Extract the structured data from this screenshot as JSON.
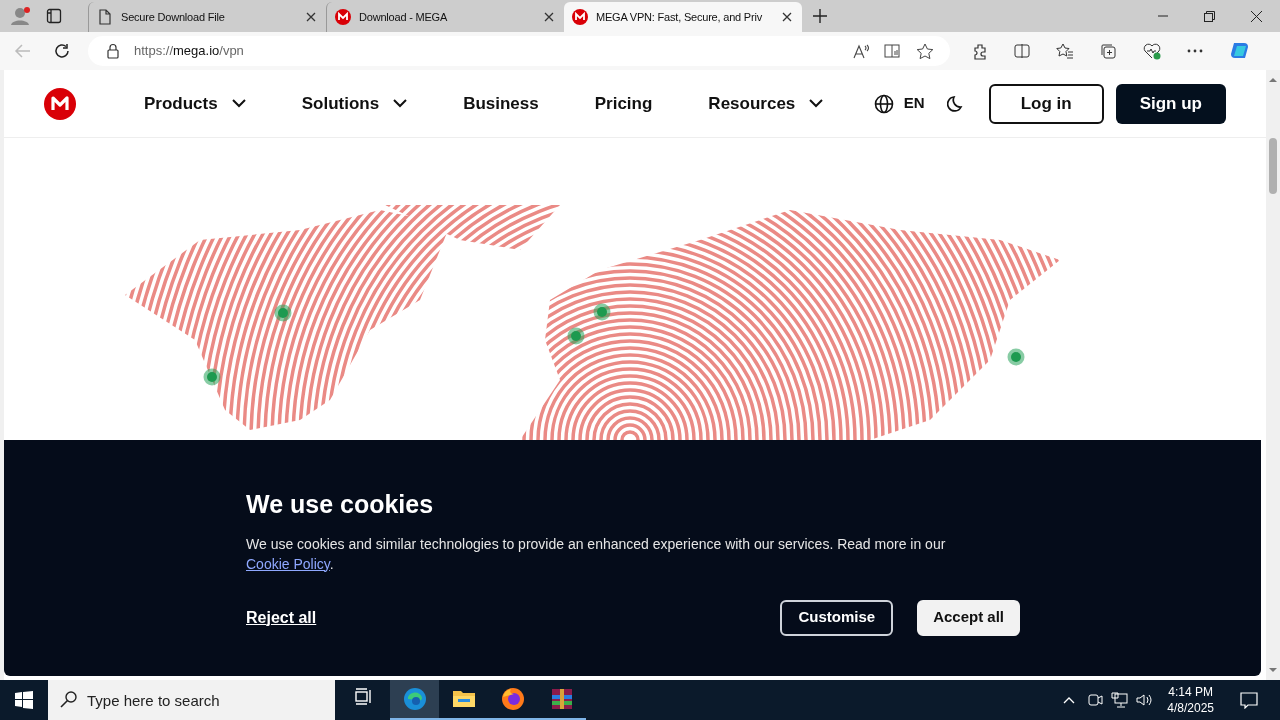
{
  "browser": {
    "tabs": [
      {
        "title": "Secure Download File",
        "kind": "page",
        "selected": false
      },
      {
        "title": "Download - MEGA",
        "kind": "mega",
        "selected": false
      },
      {
        "title": "MEGA VPN: Fast, Secure, and Priv",
        "kind": "mega",
        "selected": true
      }
    ],
    "address": {
      "scheme": "https://",
      "host": "mega.io",
      "path": "/vpn"
    }
  },
  "site": {
    "nav": [
      {
        "label": "Products",
        "dropdown": true
      },
      {
        "label": "Solutions",
        "dropdown": true
      },
      {
        "label": "Business",
        "dropdown": false
      },
      {
        "label": "Pricing",
        "dropdown": false
      },
      {
        "label": "Resources",
        "dropdown": true
      }
    ],
    "language": "EN",
    "login": "Log in",
    "signup": "Sign up"
  },
  "cookie_banner": {
    "title": "We use cookies",
    "text": "We use cookies and similar technologies to provide an enhanced experience with our services. Read more in our",
    "link": "Cookie Policy",
    "after_link": ".",
    "buttons": [
      {
        "label": "Reject all",
        "kind": "link"
      },
      {
        "label": "Customise",
        "kind": "outline"
      },
      {
        "label": "Accept all",
        "kind": "filled"
      }
    ]
  },
  "taskbar": {
    "search": {
      "placeholder": "Type here to search"
    },
    "apps": [
      {
        "kind": "taskview",
        "selected": false
      },
      {
        "kind": "edge",
        "selected": true
      },
      {
        "kind": "folder",
        "selected": false
      },
      {
        "kind": "firefox",
        "selected": false
      },
      {
        "kind": "archive",
        "selected": false
      }
    ],
    "time": "4:14 PM",
    "date": "4/8/2025"
  }
}
